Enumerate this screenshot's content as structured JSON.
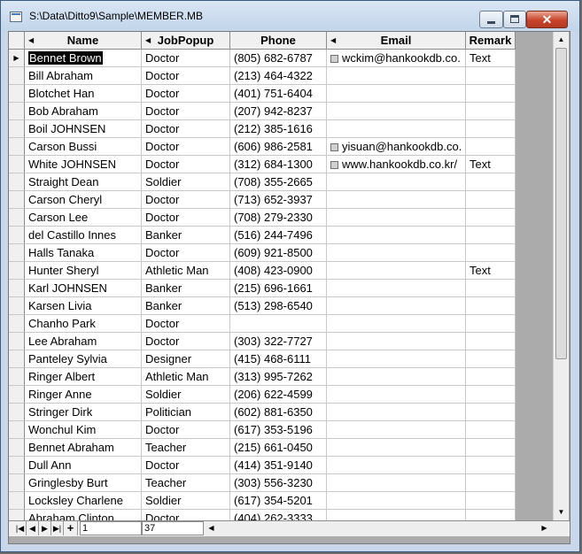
{
  "window": {
    "title": "S:\\Data\\Ditto9\\Sample\\MEMBER.MB",
    "close_label": "✕"
  },
  "columns": [
    {
      "name": "Name",
      "sort_mark": "◀"
    },
    {
      "name": "JobPopup",
      "sort_mark": "◀"
    },
    {
      "name": "Phone",
      "sort_mark": ""
    },
    {
      "name": "Email",
      "sort_mark": "◀"
    },
    {
      "name": "Remark",
      "sort_mark": ""
    }
  ],
  "current_row_marker": "▶",
  "rows": [
    {
      "name": "Bennet Brown",
      "job": "Doctor",
      "phone": "(805) 682-6787",
      "email": "wckim@hankookdb.co.",
      "remark": "Text"
    },
    {
      "name": "Bill Abraham",
      "job": "Doctor",
      "phone": "(213) 464-4322",
      "email": "",
      "remark": ""
    },
    {
      "name": "Blotchet Han",
      "job": "Doctor",
      "phone": "(401) 751-6404",
      "email": "",
      "remark": ""
    },
    {
      "name": "Bob Abraham",
      "job": "Doctor",
      "phone": "(207) 942-8237",
      "email": "",
      "remark": ""
    },
    {
      "name": "Boil JOHNSEN",
      "job": "Doctor",
      "phone": "(212) 385-1616",
      "email": "",
      "remark": ""
    },
    {
      "name": "Carson Bussi",
      "job": "Doctor",
      "phone": "(606) 986-2581",
      "email": "yisuan@hankookdb.co.",
      "remark": ""
    },
    {
      "name": "White JOHNSEN",
      "job": "Doctor",
      "phone": "(312) 684-1300",
      "email": "www.hankookdb.co.kr/",
      "remark": "Text"
    },
    {
      "name": "Straight Dean",
      "job": "Soldier",
      "phone": "(708) 355-2665",
      "email": "",
      "remark": ""
    },
    {
      "name": "Carson Cheryl",
      "job": "Doctor",
      "phone": "(713) 652-3937",
      "email": "",
      "remark": ""
    },
    {
      "name": "Carson Lee",
      "job": "Doctor",
      "phone": "(708) 279-2330",
      "email": "",
      "remark": ""
    },
    {
      "name": "del Castillo Innes",
      "job": "Banker",
      "phone": "(516) 244-7496",
      "email": "",
      "remark": ""
    },
    {
      "name": "Halls Tanaka",
      "job": "Doctor",
      "phone": "(609) 921-8500",
      "email": "",
      "remark": ""
    },
    {
      "name": "Hunter Sheryl",
      "job": "Athletic Man",
      "phone": "(408) 423-0900",
      "email": "",
      "remark": "Text"
    },
    {
      "name": "Karl JOHNSEN",
      "job": "Banker",
      "phone": "(215) 696-1661",
      "email": "",
      "remark": ""
    },
    {
      "name": "Karsen Livia",
      "job": "Banker",
      "phone": "(513) 298-6540",
      "email": "",
      "remark": ""
    },
    {
      "name": "Chanho Park",
      "job": "Doctor",
      "phone": "",
      "email": "",
      "remark": ""
    },
    {
      "name": "Lee Abraham",
      "job": "Doctor",
      "phone": "(303) 322-7727",
      "email": "",
      "remark": ""
    },
    {
      "name": "Panteley Sylvia",
      "job": "Designer",
      "phone": "(415) 468-6111",
      "email": "",
      "remark": ""
    },
    {
      "name": "Ringer Albert",
      "job": "Athletic Man",
      "phone": "(313) 995-7262",
      "email": "",
      "remark": ""
    },
    {
      "name": "Ringer Anne",
      "job": "Soldier",
      "phone": "(206) 622-4599",
      "email": "",
      "remark": ""
    },
    {
      "name": "Stringer Dirk",
      "job": "Politician",
      "phone": "(602) 881-6350",
      "email": "",
      "remark": ""
    },
    {
      "name": "Wonchul Kim",
      "job": "Doctor",
      "phone": "(617) 353-5196",
      "email": "",
      "remark": ""
    },
    {
      "name": "Bennet Abraham",
      "job": "Teacher",
      "phone": "(215) 661-0450",
      "email": "",
      "remark": ""
    },
    {
      "name": "Dull Ann",
      "job": "Doctor",
      "phone": "(414) 351-9140",
      "email": "",
      "remark": ""
    },
    {
      "name": "Gringlesby Burt",
      "job": "Teacher",
      "phone": "(303) 556-3230",
      "email": "",
      "remark": ""
    },
    {
      "name": "Locksley Charlene",
      "job": "Soldier",
      "phone": "(617) 354-5201",
      "email": "",
      "remark": ""
    },
    {
      "name": "Abraham Clinton",
      "job": "Doctor",
      "phone": "(404) 262-3333",
      "email": "",
      "remark": ""
    }
  ],
  "navigator": {
    "first": "|◀",
    "prev": "◀",
    "next": "▶",
    "last": "▶|",
    "add": "+",
    "current_record": "1",
    "record_count": "37"
  },
  "scrollbar": {
    "up": "▲",
    "down": "▼",
    "left": "◀",
    "right": "▶"
  }
}
